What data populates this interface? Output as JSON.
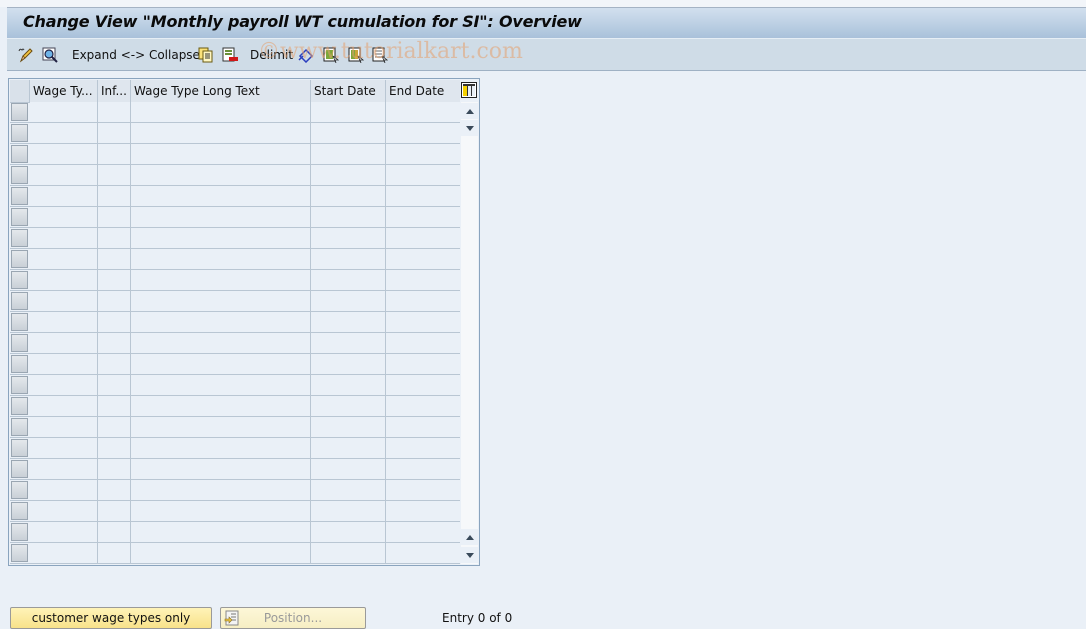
{
  "window": {
    "title": "Change View \"Monthly payroll WT cumulation for SI\": Overview"
  },
  "toolbar": {
    "items": [
      {
        "icon": "display-change-icon",
        "label": ""
      },
      {
        "icon": "search-details-icon",
        "label": ""
      },
      {
        "icon": "",
        "label": "Expand <-> Collapse"
      },
      {
        "icon": "copy-as-icon",
        "label": ""
      },
      {
        "icon": "delete-icon",
        "label": ""
      },
      {
        "icon": "",
        "label": "Delimit"
      },
      {
        "icon": "undo-change-icon",
        "label": ""
      },
      {
        "icon": "select-all-icon",
        "label": ""
      },
      {
        "icon": "select-block-icon",
        "label": ""
      },
      {
        "icon": "deselect-all-icon",
        "label": ""
      }
    ],
    "watermark": "©www.tutorialkart.com"
  },
  "table": {
    "columns": [
      {
        "key": "wage_type",
        "label": "Wage Ty..."
      },
      {
        "key": "inf",
        "label": "Inf..."
      },
      {
        "key": "long_text",
        "label": "Wage Type Long Text"
      },
      {
        "key": "start_date",
        "label": "Start Date"
      },
      {
        "key": "end_date",
        "label": "End Date"
      }
    ],
    "row_count_visible": 22,
    "rows": []
  },
  "footer": {
    "customer_button": "customer wage types only",
    "position_button": "Position...",
    "entry_status": "Entry 0 of 0"
  },
  "colors": {
    "title_gradient_top": "#d2e0ee",
    "title_gradient_bottom": "#a9c1da",
    "toolbar_bg": "#cfdce7",
    "body_bg": "#eaf0f7",
    "button_yellow": "#f8e28a"
  }
}
